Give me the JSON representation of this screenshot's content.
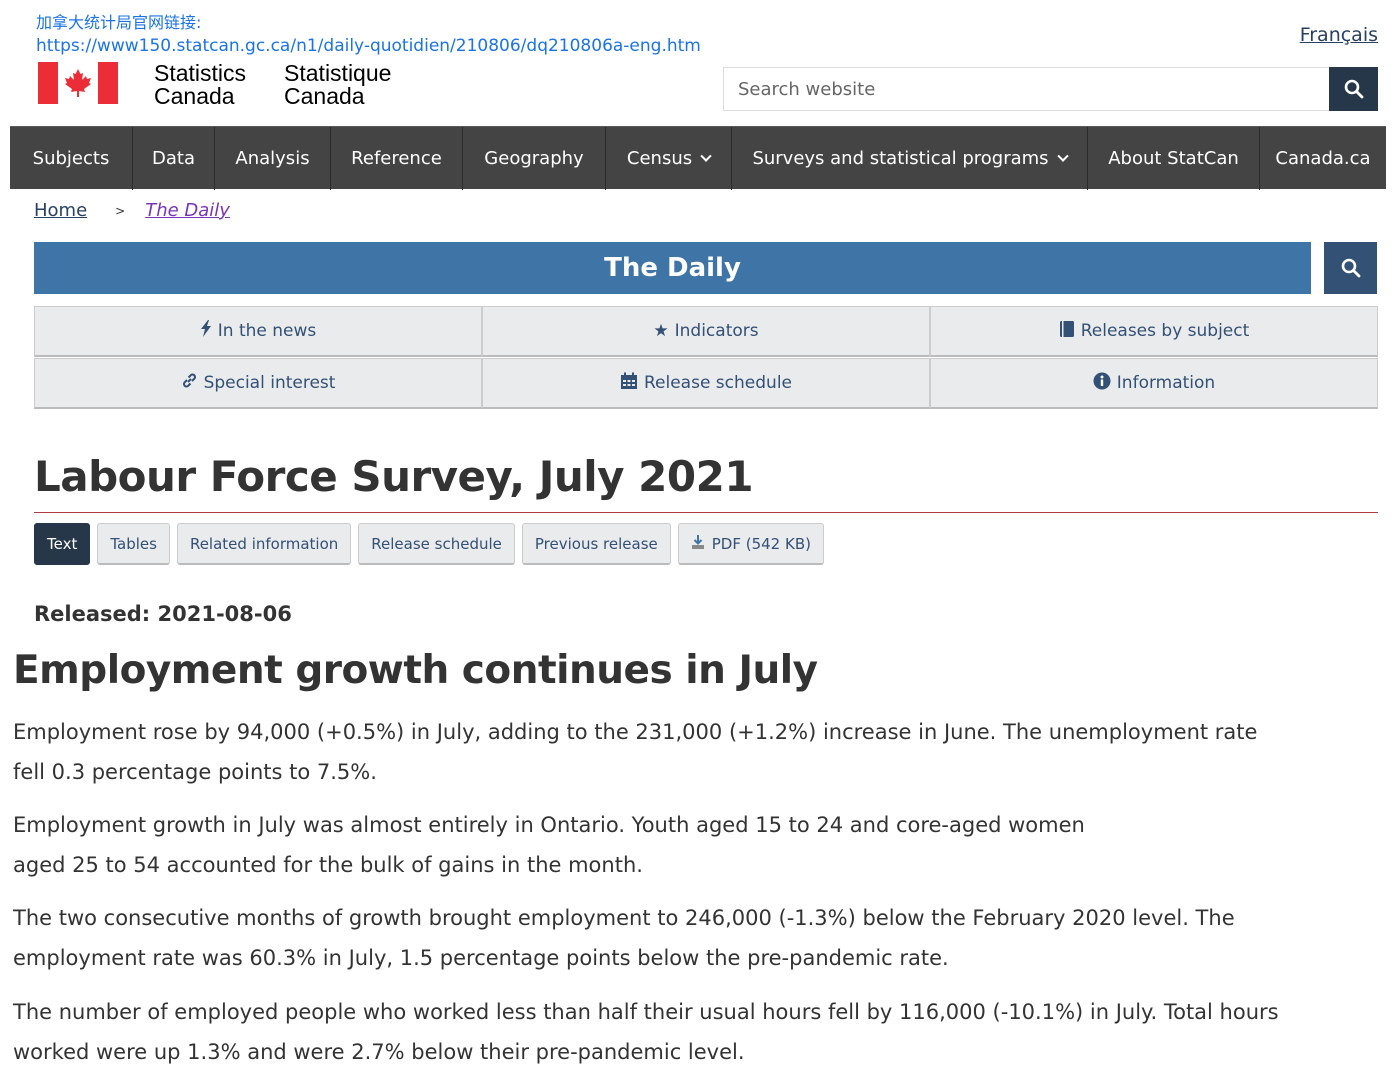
{
  "annotation": {
    "label": "加拿大统计局官网链接:",
    "url": "https://www150.statcan.gc.ca/n1/daily-quotidien/210806/dq210806a-eng.htm"
  },
  "header": {
    "language_link": "Français",
    "wordmark_en_line1": "Statistics",
    "wordmark_en_line2": "Canada",
    "wordmark_fr_line1": "Statistique",
    "wordmark_fr_line2": "Canada",
    "search_placeholder": "Search website"
  },
  "menu": {
    "items": [
      {
        "label": "Subjects"
      },
      {
        "label": "Data"
      },
      {
        "label": "Analysis"
      },
      {
        "label": "Reference"
      },
      {
        "label": "Geography"
      },
      {
        "label": "Census"
      },
      {
        "label": "Surveys and statistical programs"
      },
      {
        "label": "About StatCan"
      },
      {
        "label": "Canada.ca"
      }
    ]
  },
  "breadcrumb": {
    "home": "Home",
    "separator": ">",
    "current": "The Daily"
  },
  "daily": {
    "banner_title": "The Daily",
    "buttons": [
      {
        "label": "In the news",
        "icon": "bolt-icon"
      },
      {
        "label": "Indicators",
        "icon": "star-icon"
      },
      {
        "label": "Releases by subject",
        "icon": "book-icon"
      },
      {
        "label": "Special interest",
        "icon": "link-icon"
      },
      {
        "label": "Release schedule",
        "icon": "calendar-icon"
      },
      {
        "label": "Information",
        "icon": "info-icon"
      }
    ]
  },
  "article": {
    "title": "Labour Force Survey, July 2021",
    "tabs": [
      {
        "label": "Text"
      },
      {
        "label": "Tables"
      },
      {
        "label": "Related information"
      },
      {
        "label": "Release schedule"
      },
      {
        "label": "Previous release"
      },
      {
        "label": "PDF (542 KB)"
      }
    ],
    "released": "Released: 2021-08-06",
    "headline": "Employment growth continues in July",
    "paragraphs": [
      {
        "line1": "Employment rose by 94,000 (+0.5%) in July, adding to the 231,000 (+1.2%) increase in June. The unemployment rate",
        "line2": "fell 0.3 percentage points to 7.5%."
      },
      {
        "line1": "Employment growth in July was almost entirely in Ontario. Youth aged 15 to 24 and core-aged women",
        "line2": "aged 25 to 54 accounted for the bulk of gains in the month."
      },
      {
        "line1": "The two consecutive months of growth brought employment to 246,000 (-1.3%) below the February 2020 level. The",
        "line2": "employment rate was 60.3% in July, 1.5 percentage points below the pre-pandemic rate."
      },
      {
        "line1": "The number of employed people who worked less than half their usual hours fell by 116,000 (-10.1%) in July. Total hours",
        "line2": "worked were up 1.3% and were 2.7% below their pre-pandemic level."
      }
    ]
  },
  "colors": {
    "menu_bg": "#444444",
    "banner_bg": "#3f74a6",
    "search_button": "#26374a",
    "flag_red": "#eb2d37",
    "title_rule": "#af3c43"
  }
}
